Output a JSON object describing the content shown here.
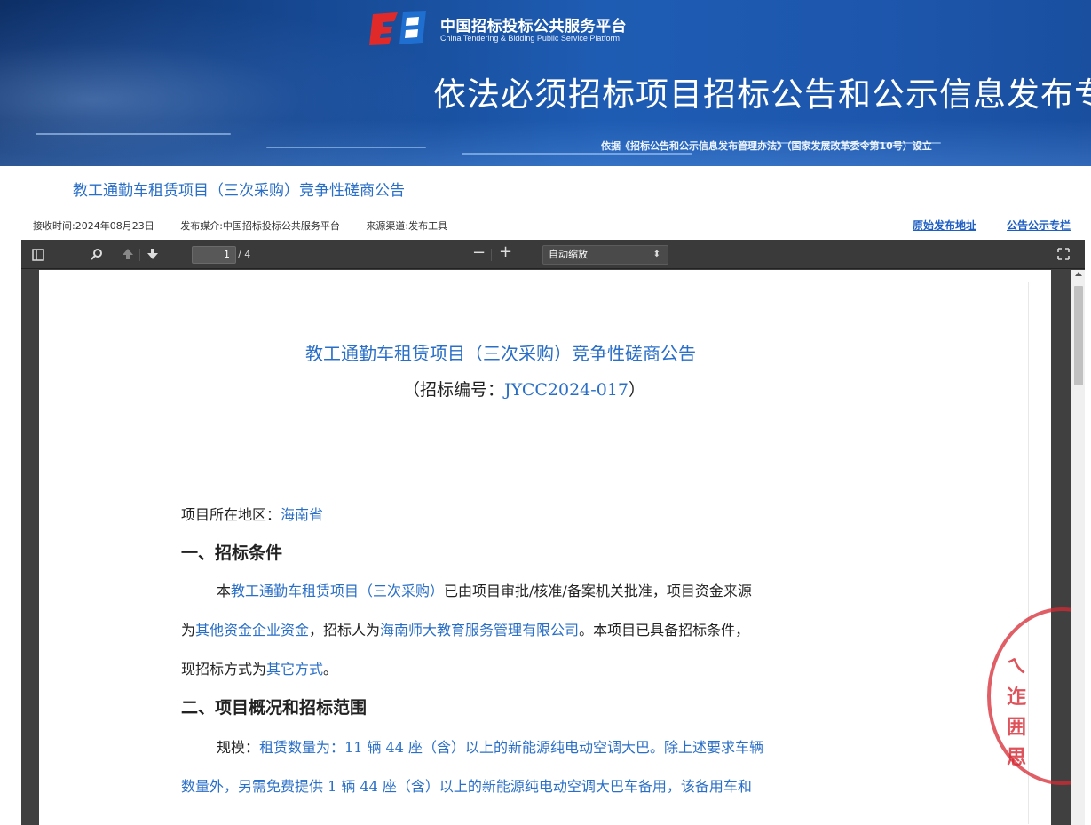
{
  "banner": {
    "site_name_cn": "中国招标投标公共服务平台",
    "site_name_en": "China Tendering & Bidding Public Service Platform",
    "title": "依法必须招标项目招标公告和公示信息发布专栏",
    "subtitle": "依据《招标公告和公示信息发布管理办法》（国家发展改革委令第10号）设立",
    "logo_icon": "platform-logo-icon"
  },
  "notice": {
    "title": "教工通勤车租赁项目（三次采购）竞争性磋商公告",
    "received_time": "接收时间:2024年08月23日",
    "media": "发布媒介:中国招标投标公共服务平台",
    "source": "来源渠道:发布工具",
    "original_link": "原始发布地址",
    "column_link": "公告公示专栏"
  },
  "viewer": {
    "sidebar_toggle_icon": "sidebar-toggle-icon",
    "search_icon": "search-icon",
    "prev_icon": "arrow-up-icon",
    "next_icon": "arrow-down-icon",
    "page_current": "1",
    "page_total": "/ 4",
    "zoom_out": "−",
    "zoom_in": "+",
    "zoom_value": "自动缩放",
    "fullscreen_icon": "fullscreen-icon"
  },
  "document": {
    "title": "教工通勤车租赁项目（三次采购）竞争性磋商公告",
    "code_prefix": "（招标编号：",
    "code_value": "JYCC2024-017",
    "code_suffix": "）",
    "region_label": "项目所在地区：",
    "region_value": "海南省",
    "section1_heading": "一、招标条件",
    "s1_p1_a": "本",
    "s1_p1_b": "教工通勤车租赁项目（三次采购）",
    "s1_p1_c": "已由项目审批/核准/备案机关批准，项目资金来源",
    "s1_p2_a": "为",
    "s1_p2_b": "其他资金企业资金",
    "s1_p2_c": "，招标人为",
    "s1_p2_d": "海南师大教育服务管理有限公司",
    "s1_p2_e": "。本项目已具备招标条件，",
    "s1_p3_a": "现招标方式为",
    "s1_p3_b": "其它方式",
    "s1_p3_c": "。",
    "section2_heading": "二、项目概况和招标范围",
    "s2_p1_a": "规模：",
    "s2_p1_b": "租赁数量为：11 辆 44 座（含）以上的新能源纯电动空调大巴。除上述要求车辆",
    "s2_p2": "数量外，另需免费提供 1 辆 44 座（含）以上的新能源纯电动空调大巴车备用，该备用车和"
  },
  "colors": {
    "link_blue": "#2a6fc7",
    "banner_blue": "#1e5cb3",
    "stamp_red": "#d62832"
  }
}
